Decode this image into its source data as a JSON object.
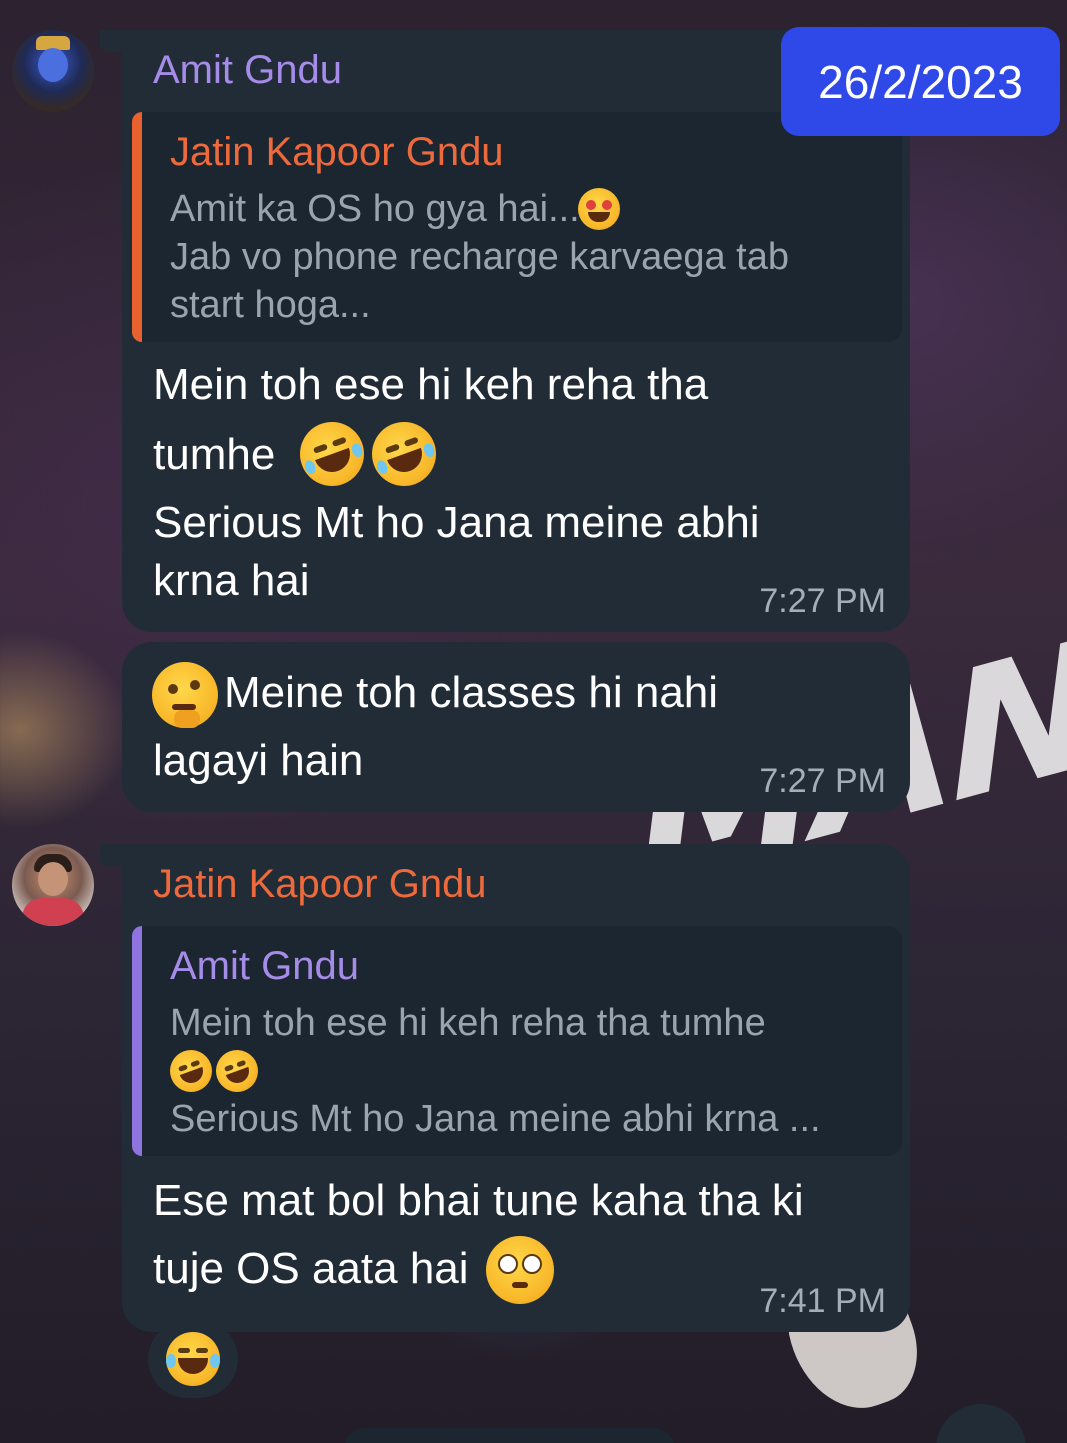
{
  "date_chip": "26/2/2023",
  "messages": [
    {
      "sender": "Amit Gndu",
      "reply": {
        "name": "Jatin Kapoor Gndu",
        "lines": [
          "Amit ka OS ho gya hai...",
          "Jab vo phone recharge karvaega tab",
          "start hoga..."
        ],
        "emoji": "star-struck-emoji"
      },
      "lines": [
        "Mein toh ese hi keh reha tha",
        "tumhe",
        "Serious Mt ho Jana meine abhi",
        "krna hai"
      ],
      "emojis": [
        "rolling-laughing-emoji",
        "rolling-laughing-emoji"
      ],
      "time": "7:27 PM"
    },
    {
      "sender": "",
      "lines": [
        "Meine toh classes hi nahi",
        "lagayi hain"
      ],
      "emojis": [
        "thinking-face-emoji"
      ],
      "time": "7:27 PM"
    },
    {
      "sender": "Jatin Kapoor Gndu",
      "reply": {
        "name": "Amit Gndu",
        "lines": [
          "Mein toh ese hi keh reha tha tumhe",
          "",
          "Serious Mt ho Jana meine abhi krna ..."
        ],
        "emoji": "rolling-laughing-emoji"
      },
      "lines": [
        "Ese mat bol bhai tune kaha tha ki",
        "tuje OS aata hai"
      ],
      "emojis": [
        "flushed-face-emoji"
      ],
      "time": "7:41 PM",
      "reaction": "joy-emoji"
    }
  ],
  "colors": {
    "bubble": "#212c36",
    "purple_name": "#a58ce8",
    "orange_name": "#ee6a3c",
    "date_chip": "#2f48e8",
    "time_text": "#a4aeb8"
  },
  "wallpaper_text": "MAN"
}
